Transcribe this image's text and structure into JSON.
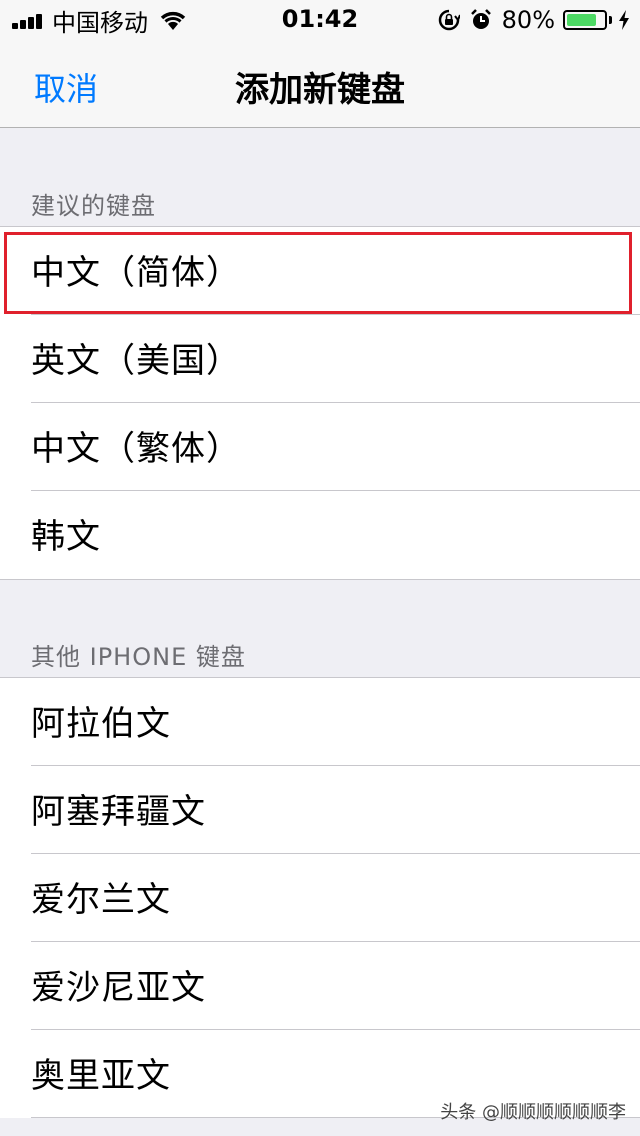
{
  "status_bar": {
    "carrier": "中国移动",
    "time": "01:42",
    "battery_percent": "80%",
    "battery_level": 0.8,
    "icons": [
      "signal-icon",
      "wifi-icon",
      "rotation-lock-icon",
      "alarm-icon",
      "battery-icon",
      "charging-icon"
    ]
  },
  "nav": {
    "cancel_label": "取消",
    "title": "添加新键盘"
  },
  "suggested": {
    "header": "建议的键盘",
    "items": [
      {
        "label": "中文（简体）"
      },
      {
        "label": "英文（美国）"
      },
      {
        "label": "中文（繁体）"
      },
      {
        "label": "韩文"
      }
    ]
  },
  "other": {
    "header": "其他 IPHONE 键盘",
    "items": [
      {
        "label": "阿拉伯文"
      },
      {
        "label": "阿塞拜疆文"
      },
      {
        "label": "爱尔兰文"
      },
      {
        "label": "爱沙尼亚文"
      },
      {
        "label": "奥里亚文"
      }
    ]
  },
  "colors": {
    "accent": "#007aff",
    "highlight": "#e0202c",
    "battery": "#4cd964"
  },
  "watermark": "头条 @顺顺顺顺顺顺李"
}
